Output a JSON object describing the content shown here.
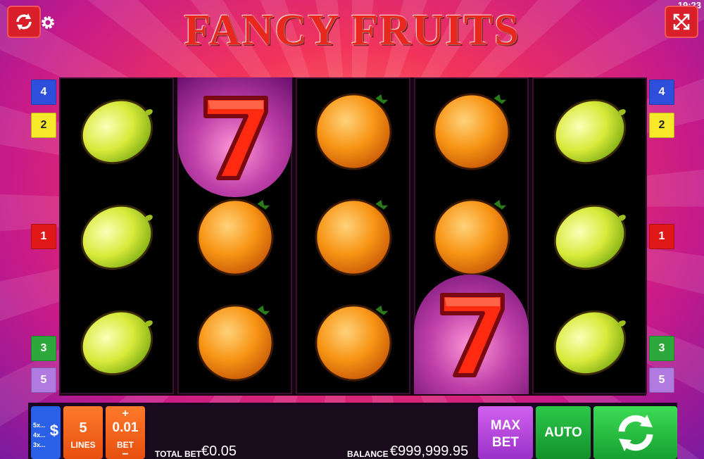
{
  "header": {
    "title": "FANCY FRUITS",
    "clock": "19:23",
    "left_icon": "refresh-icon",
    "settings_icon": "gear-icon",
    "right_icon": "fullscreen-icon"
  },
  "reels": [
    [
      "lemon",
      "lemon",
      "lemon"
    ],
    [
      "seven",
      "orange",
      "orange"
    ],
    [
      "orange",
      "orange",
      "orange"
    ],
    [
      "orange",
      "orange",
      "seven"
    ],
    [
      "lemon",
      "lemon",
      "lemon"
    ]
  ],
  "paylines": {
    "left": [
      "4",
      "2",
      "1",
      "3",
      "5"
    ],
    "right": [
      "4",
      "2",
      "1",
      "3",
      "5"
    ]
  },
  "controls": {
    "coin_multipliers": [
      "5x...",
      "4x...",
      "3x..."
    ],
    "coin_symbol": "$",
    "lines_value": "5",
    "lines_label": "LINES",
    "bet_plus": "+",
    "bet_value": "0.01",
    "bet_label": "BET",
    "bet_minus": "−",
    "total_bet_label": "TOTAL BET",
    "total_bet_value": "€0.05",
    "balance_label": "BALANCE",
    "balance_value": "€999,999.95",
    "max_bet_label_1": "MAX",
    "max_bet_label_2": "BET",
    "auto_label": "AUTO",
    "spin_icon": "spin-arrows-icon"
  },
  "colors": {
    "accent_red": "#d9202a",
    "spin_green": "#2cc84a",
    "max_bet_purple": "#b64ce0",
    "lines_orange": "#f2651e",
    "coin_blue": "#2a5fe8"
  }
}
